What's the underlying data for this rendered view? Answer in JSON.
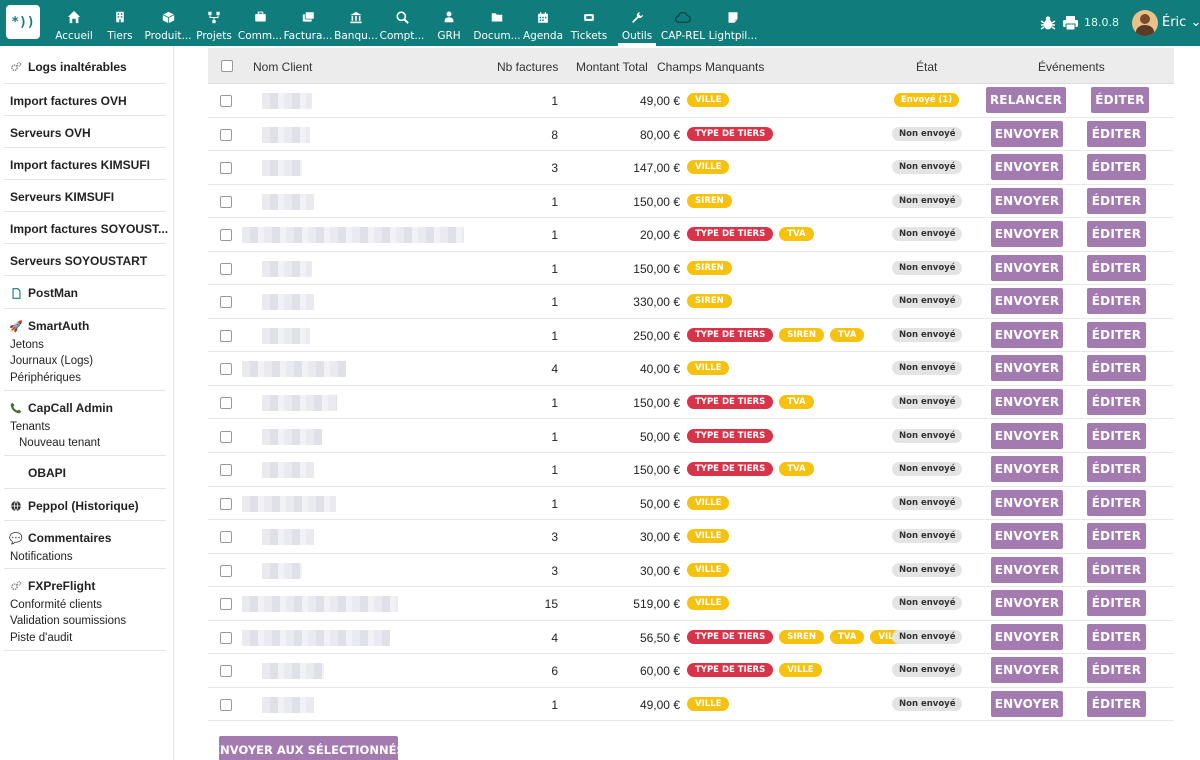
{
  "colors": {
    "brand": "#107c7c",
    "button": "#a47bb0",
    "tag_red": "#d9334a",
    "tag_yellow": "#f6c20d",
    "state_grey": "#e3e3e3"
  },
  "topbar": {
    "logo_text": "*))",
    "menu": [
      {
        "label": "Accueil",
        "icon": "home-icon"
      },
      {
        "label": "Tiers",
        "icon": "building-icon"
      },
      {
        "label": "Produit...",
        "icon": "cube-icon"
      },
      {
        "label": "Projets",
        "icon": "sitemap-icon"
      },
      {
        "label": "Comm...",
        "icon": "briefcase-icon"
      },
      {
        "label": "Factura...",
        "icon": "money-icon"
      },
      {
        "label": "Banqu...",
        "icon": "bank-icon"
      },
      {
        "label": "Compt...",
        "icon": "search-dollar-icon"
      },
      {
        "label": "GRH",
        "icon": "user-tie-icon"
      },
      {
        "label": "Docum...",
        "icon": "folder-icon"
      },
      {
        "label": "Agenda",
        "icon": "calendar-icon"
      },
      {
        "label": "Tickets",
        "icon": "ticket-icon"
      },
      {
        "label": "Outils",
        "icon": "wrench-icon"
      },
      {
        "label": "CAP-REL",
        "icon": "cloud-icon"
      },
      {
        "label": "Lightpil...",
        "icon": "note-icon"
      }
    ],
    "active_index": 12,
    "version": "18.0.8",
    "user": "Éric"
  },
  "sidebar": {
    "blocks": [
      {
        "title": "Logs inaltérables",
        "icon": "cogs-icon",
        "subs": []
      },
      {
        "title": "Import factures OVH",
        "icon": "",
        "subs": []
      },
      {
        "title": "Serveurs OVH",
        "icon": "",
        "subs": []
      },
      {
        "title": "Import factures KIMSUFI",
        "icon": "",
        "subs": []
      },
      {
        "title": "Serveurs KIMSUFI",
        "icon": "",
        "subs": []
      },
      {
        "title": "Import factures SOYOUST...",
        "icon": "",
        "subs": []
      },
      {
        "title": "Serveurs SOYOUSTART",
        "icon": "",
        "subs": []
      },
      {
        "title": "PostMan",
        "icon": "file-icon",
        "subs": []
      },
      {
        "title": "SmartAuth",
        "icon": "rocket-icon",
        "subs": [
          "Jetons",
          "Journaux (Logs)",
          "Périphériques"
        ]
      },
      {
        "title": "CapCall Admin",
        "icon": "phone-icon",
        "subs": [
          "Tenants",
          "Nouveau tenant"
        ]
      },
      {
        "title": "OBAPI",
        "icon": "blank-icon",
        "subs": []
      },
      {
        "title": "Peppol (Historique)",
        "icon": "globe-icon",
        "subs": []
      },
      {
        "title": "Commentaires",
        "icon": "comment-icon",
        "subs": [
          "Notifications"
        ]
      },
      {
        "title": "FXPreFlight",
        "icon": "cogs-icon",
        "subs": [
          "Conformité clients",
          "Validation soumissions",
          "Piste d'audit"
        ]
      }
    ]
  },
  "table": {
    "headers": {
      "client": "Nom Client",
      "nb": "Nb factures",
      "amount": "Montant Total",
      "missing": "Champs Manquants",
      "state": "État",
      "events": "Événements"
    },
    "rows": [
      {
        "nb": "1",
        "amount": "49,00 €",
        "tags": [
          "VILLE"
        ],
        "state": "Envoyé (1)",
        "sent": true,
        "action": "RELANCER",
        "edit": "ÉDITER"
      },
      {
        "nb": "8",
        "amount": "80,00 €",
        "tags": [
          "TYPE DE TIERS"
        ],
        "state": "Non envoyé",
        "sent": false,
        "action": "ENVOYER",
        "edit": "ÉDITER"
      },
      {
        "nb": "3",
        "amount": "147,00 €",
        "tags": [
          "VILLE"
        ],
        "state": "Non envoyé",
        "sent": false,
        "action": "ENVOYER",
        "edit": "ÉDITER"
      },
      {
        "nb": "1",
        "amount": "150,00 €",
        "tags": [
          "SIREN"
        ],
        "state": "Non envoyé",
        "sent": false,
        "action": "ENVOYER",
        "edit": "ÉDITER"
      },
      {
        "nb": "1",
        "amount": "20,00 €",
        "tags": [
          "TYPE DE TIERS",
          "TVA"
        ],
        "state": "Non envoyé",
        "sent": false,
        "action": "ENVOYER",
        "edit": "ÉDITER"
      },
      {
        "nb": "1",
        "amount": "150,00 €",
        "tags": [
          "SIREN"
        ],
        "state": "Non envoyé",
        "sent": false,
        "action": "ENVOYER",
        "edit": "ÉDITER"
      },
      {
        "nb": "1",
        "amount": "330,00 €",
        "tags": [
          "SIREN"
        ],
        "state": "Non envoyé",
        "sent": false,
        "action": "ENVOYER",
        "edit": "ÉDITER"
      },
      {
        "nb": "1",
        "amount": "250,00 €",
        "tags": [
          "TYPE DE TIERS",
          "SIREN",
          "TVA"
        ],
        "state": "Non envoyé",
        "sent": false,
        "action": "ENVOYER",
        "edit": "ÉDITER"
      },
      {
        "nb": "4",
        "amount": "40,00 €",
        "tags": [
          "VILLE"
        ],
        "state": "Non envoyé",
        "sent": false,
        "action": "ENVOYER",
        "edit": "ÉDITER"
      },
      {
        "nb": "1",
        "amount": "150,00 €",
        "tags": [
          "TYPE DE TIERS",
          "TVA"
        ],
        "state": "Non envoyé",
        "sent": false,
        "action": "ENVOYER",
        "edit": "ÉDITER"
      },
      {
        "nb": "1",
        "amount": "50,00 €",
        "tags": [
          "TYPE DE TIERS"
        ],
        "state": "Non envoyé",
        "sent": false,
        "action": "ENVOYER",
        "edit": "ÉDITER"
      },
      {
        "nb": "1",
        "amount": "150,00 €",
        "tags": [
          "TYPE DE TIERS",
          "TVA"
        ],
        "state": "Non envoyé",
        "sent": false,
        "action": "ENVOYER",
        "edit": "ÉDITER"
      },
      {
        "nb": "1",
        "amount": "50,00 €",
        "tags": [
          "VILLE"
        ],
        "state": "Non envoyé",
        "sent": false,
        "action": "ENVOYER",
        "edit": "ÉDITER"
      },
      {
        "nb": "3",
        "amount": "30,00 €",
        "tags": [
          "VILLE"
        ],
        "state": "Non envoyé",
        "sent": false,
        "action": "ENVOYER",
        "edit": "ÉDITER"
      },
      {
        "nb": "3",
        "amount": "30,00 €",
        "tags": [
          "VILLE"
        ],
        "state": "Non envoyé",
        "sent": false,
        "action": "ENVOYER",
        "edit": "ÉDITER"
      },
      {
        "nb": "15",
        "amount": "519,00 €",
        "tags": [
          "VILLE"
        ],
        "state": "Non envoyé",
        "sent": false,
        "action": "ENVOYER",
        "edit": "ÉDITER"
      },
      {
        "nb": "4",
        "amount": "56,50 €",
        "tags": [
          "TYPE DE TIERS",
          "SIREN",
          "TVA",
          "VILLE"
        ],
        "state": "Non envoyé",
        "sent": false,
        "action": "ENVOYER",
        "edit": "ÉDITER"
      },
      {
        "nb": "6",
        "amount": "60,00 €",
        "tags": [
          "TYPE DE TIERS",
          "VILLE"
        ],
        "state": "Non envoyé",
        "sent": false,
        "action": "ENVOYER",
        "edit": "ÉDITER"
      },
      {
        "nb": "1",
        "amount": "49,00 €",
        "tags": [
          "VILLE"
        ],
        "state": "Non envoyé",
        "sent": false,
        "action": "ENVOYER",
        "edit": "ÉDITER"
      }
    ],
    "bulk_action": "ENVOYER AUX SÉLECTIONNÉS"
  }
}
